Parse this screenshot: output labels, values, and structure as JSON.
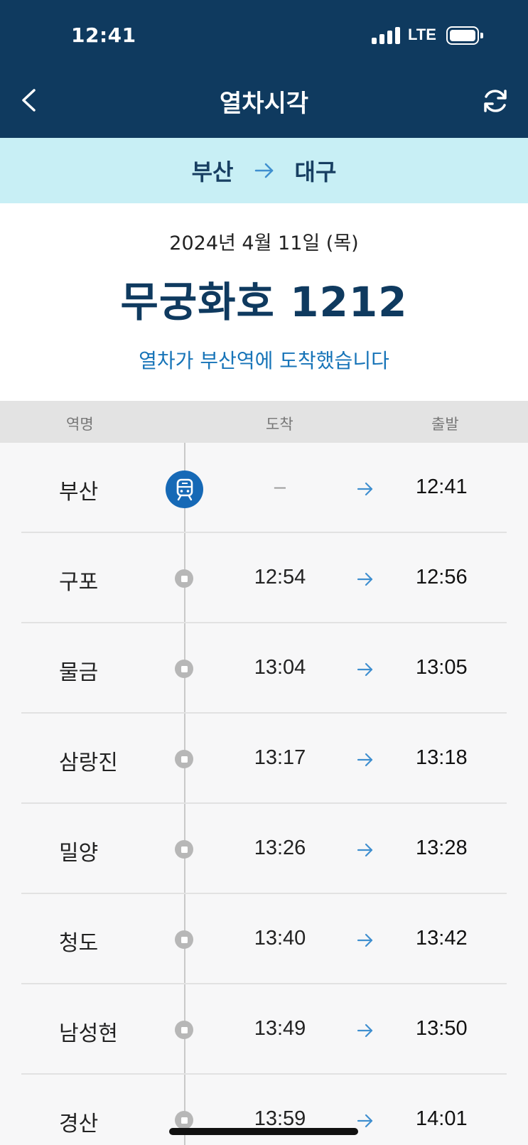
{
  "status_bar": {
    "time": "12:41",
    "network": "LTE"
  },
  "header": {
    "title": "열차시각",
    "back_icon": "chevron-left-icon",
    "refresh_icon": "refresh-icon"
  },
  "route": {
    "from": "부산",
    "to": "대구"
  },
  "info": {
    "date": "2024년 4월 11일 (목)",
    "train": "무궁화호 1212",
    "status": "열차가 부산역에 도착했습니다"
  },
  "table": {
    "headers": {
      "station": "역명",
      "arrival": "도착",
      "departure": "출발"
    },
    "rows": [
      {
        "station": "부산",
        "arrival": "–",
        "departure": "12:41",
        "current": true
      },
      {
        "station": "구포",
        "arrival": "12:54",
        "departure": "12:56"
      },
      {
        "station": "물금",
        "arrival": "13:04",
        "departure": "13:05"
      },
      {
        "station": "삼랑진",
        "arrival": "13:17",
        "departure": "13:18"
      },
      {
        "station": "밀양",
        "arrival": "13:26",
        "departure": "13:28"
      },
      {
        "station": "청도",
        "arrival": "13:40",
        "departure": "13:42"
      },
      {
        "station": "남성현",
        "arrival": "13:49",
        "departure": "13:50"
      },
      {
        "station": "경산",
        "arrival": "13:59",
        "departure": "14:01"
      }
    ]
  },
  "colors": {
    "header_bg": "#0f3a5f",
    "route_bg": "#c8eff5",
    "accent": "#1669b6",
    "status_text": "#1774b8"
  }
}
